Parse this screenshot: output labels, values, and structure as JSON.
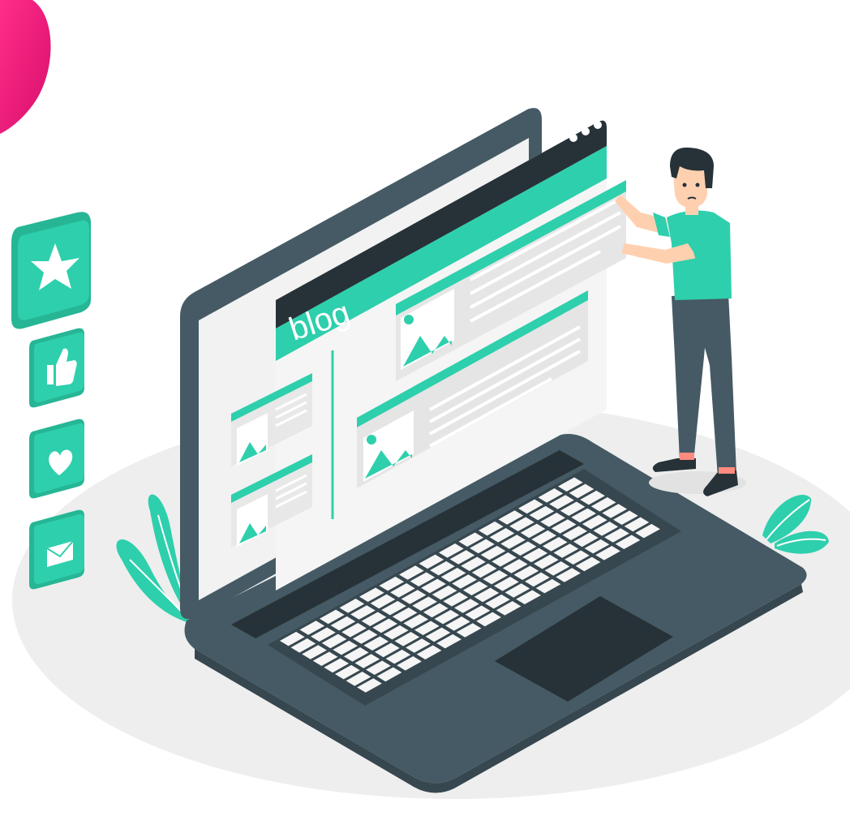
{
  "illustration": {
    "blog_label": "blog",
    "colors": {
      "accent": "#2ecfac",
      "accent_dark": "#26b695",
      "laptop_body": "#455a64",
      "laptop_dark": "#263238",
      "screen_bg": "#f2f2f2",
      "floor": "#eeeeee",
      "pink": "#f0157a"
    },
    "side_icons": [
      "star-icon",
      "thumbs-up-icon",
      "heart-icon",
      "mail-icon"
    ]
  }
}
